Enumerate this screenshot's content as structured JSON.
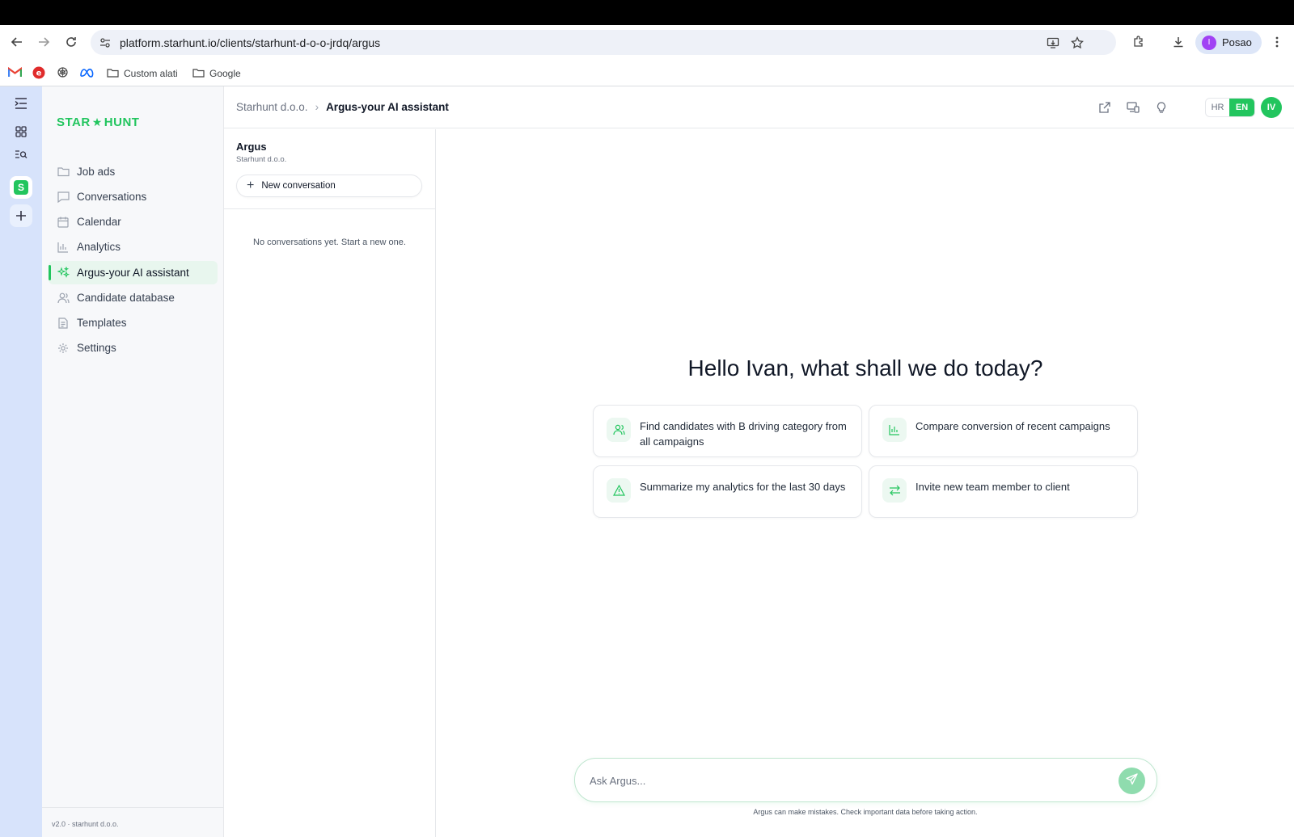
{
  "browser": {
    "url": "platform.starhunt.io/clients/starhunt-d-o-o-jrdq/argus",
    "profile_initial": "I",
    "profile_name": "Posao",
    "bookmarks": [
      {
        "label": "",
        "icon": "gmail-icon"
      },
      {
        "label": "",
        "icon": "red-e-icon"
      },
      {
        "label": "",
        "icon": "openai-icon"
      },
      {
        "label": "",
        "icon": "meta-icon"
      },
      {
        "label": "Custom alati",
        "icon": "folder-icon"
      },
      {
        "label": "Google",
        "icon": "folder-icon"
      }
    ]
  },
  "rail": {
    "workspace_badge": "S"
  },
  "sidebar": {
    "logo_left": "STAR",
    "logo_right": "HUNT",
    "items": [
      {
        "label": "Job ads",
        "icon": "folder-icon"
      },
      {
        "label": "Conversations",
        "icon": "chat-icon"
      },
      {
        "label": "Calendar",
        "icon": "calendar-icon"
      },
      {
        "label": "Analytics",
        "icon": "bar-chart-icon"
      },
      {
        "label": "Argus-your AI assistant",
        "icon": "sparkle-icon"
      },
      {
        "label": "Candidate database",
        "icon": "users-icon"
      },
      {
        "label": "Templates",
        "icon": "document-icon"
      },
      {
        "label": "Settings",
        "icon": "gear-icon"
      }
    ],
    "footer": "v2.0 · starhunt d.o.o."
  },
  "header": {
    "breadcrumb_parent": "Starhunt d.o.o.",
    "breadcrumb_current": "Argus-your AI assistant",
    "lang_hr": "HR",
    "lang_en": "EN",
    "avatar": "IV"
  },
  "conversations": {
    "title": "Argus",
    "subtitle": "Starhunt d.o.o.",
    "new_label": "New conversation",
    "empty_text": "No conversations yet. Start a new one."
  },
  "main": {
    "greeting": "Hello Ivan, what shall we do today?",
    "suggestions": [
      {
        "text": "Find candidates with B driving category from all campaigns",
        "icon": "users-icon"
      },
      {
        "text": "Compare conversion of recent campaigns",
        "icon": "bar-chart-icon"
      },
      {
        "text": "Summarize my analytics for the last 30 days",
        "icon": "warning-icon"
      },
      {
        "text": "Invite new team member to client",
        "icon": "swap-icon"
      }
    ],
    "input_placeholder": "Ask Argus...",
    "disclaimer": "Argus can make mistakes. Check important data before taking action."
  },
  "colors": {
    "accent": "#22c55e",
    "rail": "#d7e3fb"
  }
}
